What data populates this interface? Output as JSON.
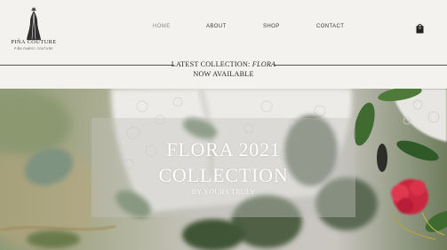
{
  "brand": {
    "name": "PIÑA COUTURE",
    "tagline": "PIÑA FABRIC COUTURE"
  },
  "nav": {
    "items": [
      {
        "label": "HOME",
        "active": true
      },
      {
        "label": "ABOUT",
        "active": false
      },
      {
        "label": "SHOP",
        "active": false
      },
      {
        "label": "CONTACT",
        "active": false
      }
    ],
    "cart_count": "0"
  },
  "announcement": {
    "prefix": "LATEST COLLECTION: ",
    "collection": "FLORA",
    "line2": "NOW AVAILABLE"
  },
  "hero": {
    "title_line1": "FLORA 2021",
    "title_line2": "COLLECTION",
    "subtitle": "BY YOURS TRULY"
  },
  "colors": {
    "background": "#f3f1ed",
    "text": "#2b2b2b",
    "nav_active": "#8a8a8a",
    "rose": "#d62f4a"
  },
  "icons": [
    "cart-icon",
    "logo-mark-icon"
  ]
}
